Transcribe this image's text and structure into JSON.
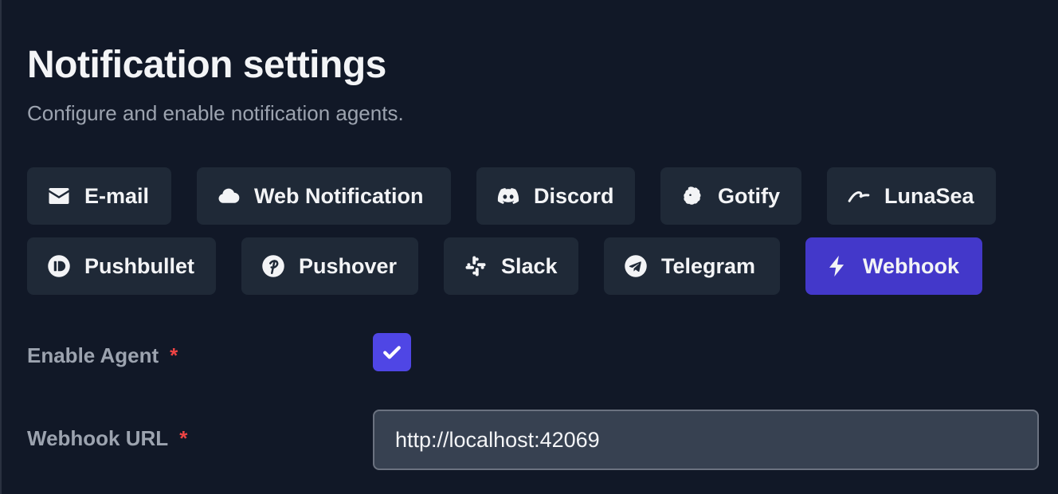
{
  "header": {
    "title": "Notification settings",
    "subtitle": "Configure and enable notification agents."
  },
  "tabs": [
    {
      "label": "E-mail",
      "icon": "envelope-icon",
      "active": false
    },
    {
      "label": "Web Notification",
      "icon": "cloud-icon",
      "active": false
    },
    {
      "label": "Discord",
      "icon": "discord-icon",
      "active": false
    },
    {
      "label": "Gotify",
      "icon": "gotify-icon",
      "active": false
    },
    {
      "label": "LunaSea",
      "icon": "lunasea-icon",
      "active": false
    },
    {
      "label": "Pushbullet",
      "icon": "pushbullet-icon",
      "active": false
    },
    {
      "label": "Pushover",
      "icon": "pushover-icon",
      "active": false
    },
    {
      "label": "Slack",
      "icon": "slack-icon",
      "active": false
    },
    {
      "label": "Telegram",
      "icon": "telegram-icon",
      "active": false
    },
    {
      "label": "Webhook",
      "icon": "lightning-bolt-icon",
      "active": true
    }
  ],
  "form": {
    "enable_agent": {
      "label": "Enable Agent",
      "required_mark": "*",
      "checked": true
    },
    "webhook_url": {
      "label": "Webhook URL",
      "required_mark": "*",
      "value": "http://localhost:42069"
    }
  },
  "colors": {
    "background": "#111827",
    "tab_background": "#1f2937",
    "active_tab": "#4338ca",
    "checkbox": "#4f46e5",
    "required": "#ef4444"
  }
}
